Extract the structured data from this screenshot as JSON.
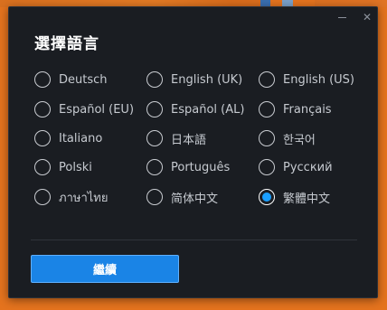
{
  "dialog": {
    "title": "選擇語言",
    "minimize_icon": "minimize-icon",
    "close_icon": "close-icon",
    "close_glyph": "✕",
    "continue_label": "繼續",
    "selected_language": "繁體中文",
    "accent_color": "#1a9fff"
  },
  "languages": [
    {
      "label": "Deutsch",
      "checked": false
    },
    {
      "label": "English (UK)",
      "checked": false
    },
    {
      "label": "English (US)",
      "checked": false
    },
    {
      "label": "Español (EU)",
      "checked": false
    },
    {
      "label": "Español (AL)",
      "checked": false
    },
    {
      "label": "Français",
      "checked": false
    },
    {
      "label": "Italiano",
      "checked": false
    },
    {
      "label": "日本語",
      "checked": false
    },
    {
      "label": "한국어",
      "checked": false
    },
    {
      "label": "Polski",
      "checked": false
    },
    {
      "label": "Português",
      "checked": false
    },
    {
      "label": "Русский",
      "checked": false
    },
    {
      "label": "ภาษาไทย",
      "checked": false
    },
    {
      "label": "简体中文",
      "checked": false
    },
    {
      "label": "繁體中文",
      "checked": true
    }
  ]
}
